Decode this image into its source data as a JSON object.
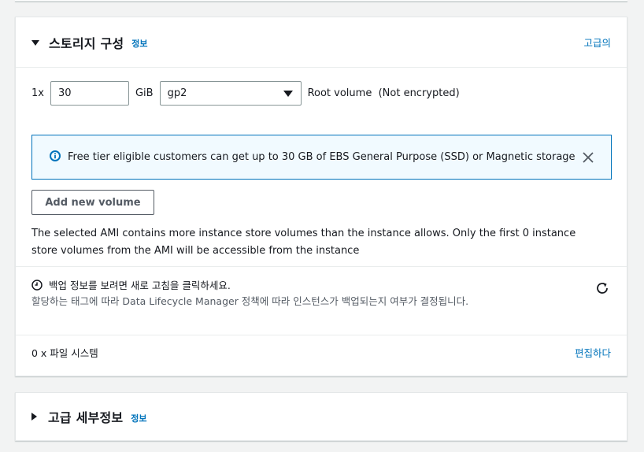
{
  "storage": {
    "title": "스토리지 구성",
    "info_label": "정보",
    "advanced_link": "고급의",
    "multiplier": "1x",
    "size_value": "30",
    "size_unit": "GiB",
    "volume_type": "gp2",
    "root_volume_label": "Root volume  (Not encrypted)",
    "alert_text": "Free tier eligible customers can get up to 30 GB of EBS General Purpose (SSD) or Magnetic storage",
    "add_volume_label": "Add new volume",
    "ami_note": "The selected AMI contains more instance store volumes than the instance allows. Only the first 0 instance store volumes from the AMI will be accessible from the instance",
    "backup_title": "백업 정보를 보려면 새로 고침을 클릭하세요.",
    "backup_desc": "할당하는 태그에 따라 Data Lifecycle Manager 정책에 따라 인스턴스가 백업되는지 여부가 결정됩니다.",
    "file_systems": "0 x 파일 시스템",
    "edit_link": "편집하다"
  },
  "advanced": {
    "title": "고급 세부정보",
    "info_label": "정보"
  },
  "icons": {
    "info": "info-circle-icon",
    "close": "close-icon",
    "clock": "clock-icon",
    "refresh": "refresh-icon"
  },
  "colors": {
    "link": "#0073bb",
    "alert_bg": "#f1faff",
    "alert_border": "#0073bb"
  }
}
